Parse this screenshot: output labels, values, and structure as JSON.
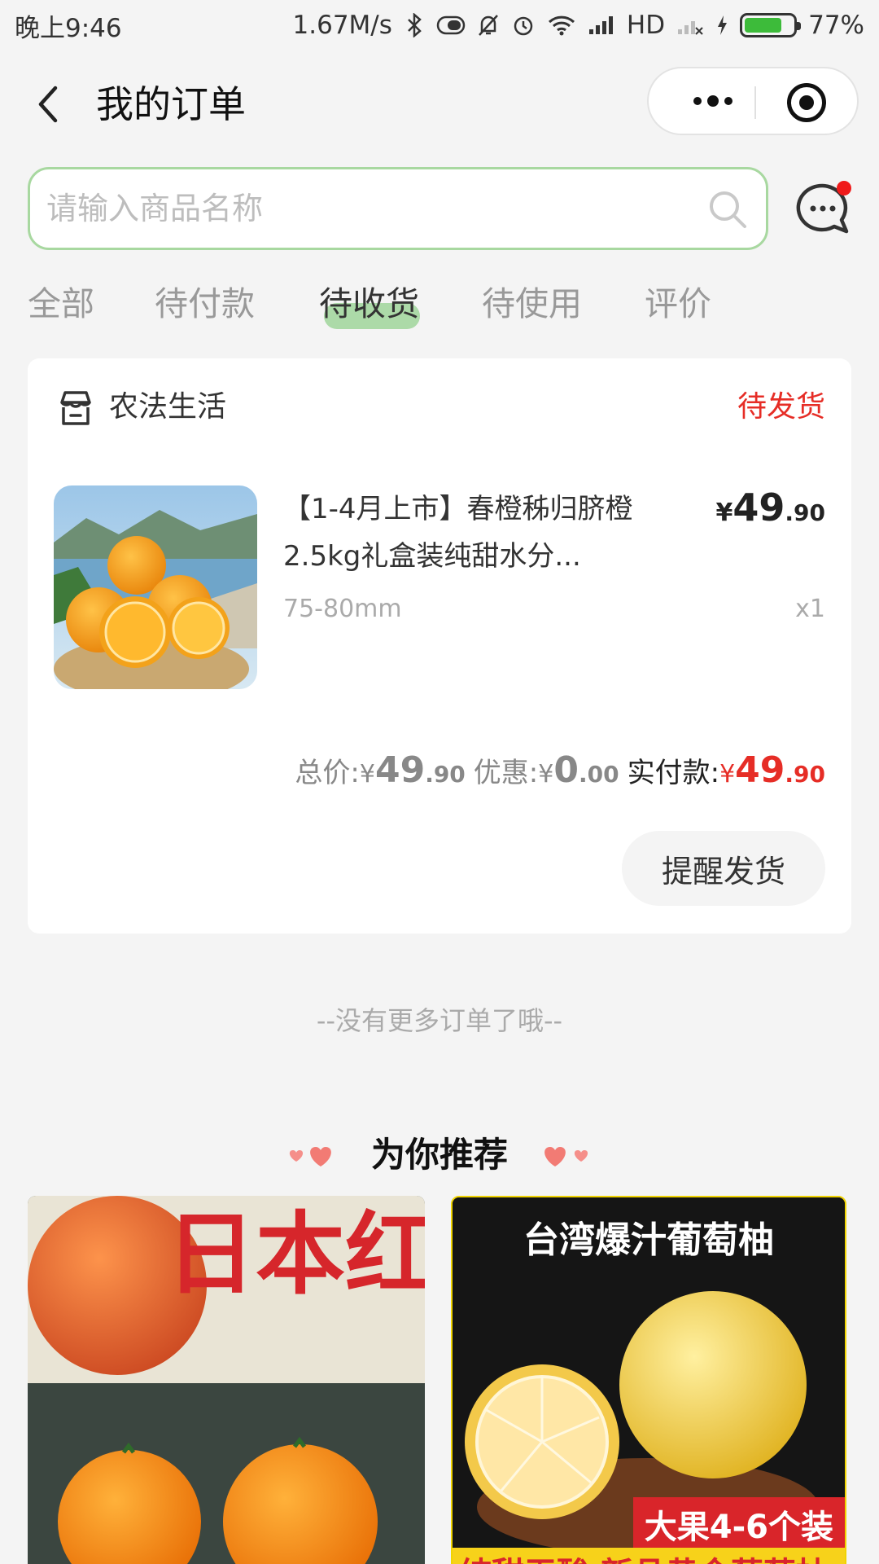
{
  "status_bar": {
    "time": "晚上9:46",
    "speed": "1.67M/s",
    "network": "HD",
    "battery": "77%",
    "battery_level": 0.77
  },
  "header": {
    "title": "我的订单"
  },
  "search": {
    "placeholder": "请输入商品名称"
  },
  "tabs": [
    {
      "label": "全部",
      "active": false
    },
    {
      "label": "待付款",
      "active": false
    },
    {
      "label": "待收货",
      "active": true
    },
    {
      "label": "待使用",
      "active": false
    },
    {
      "label": "评价",
      "active": false
    }
  ],
  "order": {
    "shop_name": "农法生活",
    "status": "待发货",
    "product": {
      "title": "【1-4月上市】春橙秭归脐橙2.5kg礼盒装纯甜水分...",
      "price_currency": "¥",
      "price_int": "49",
      "price_dec": ".90",
      "spec": "75-80mm",
      "quantity": "x1"
    },
    "summary": {
      "total_label": "总价:",
      "total_currency": "¥",
      "total_int": "49",
      "total_dec": ".90",
      "discount_label": "优惠:",
      "discount_currency": "¥",
      "discount_int": "0",
      "discount_dec": ".00",
      "paid_label": "实付款:",
      "paid_currency": "¥",
      "paid_int": "49",
      "paid_dec": ".90"
    },
    "remind_button": "提醒发货"
  },
  "no_more_text": "--没有更多订单了哦--",
  "recommend": {
    "title": "为你推荐",
    "items": [
      {
        "image_text": "日本红美人"
      },
      {
        "image_text": "台湾爆汁葡萄柚",
        "badge": "大果4-6个装",
        "strip": "纯甜无酸 新品黄金葡萄柚"
      }
    ]
  },
  "colors": {
    "accent_green": "#a8d8a0",
    "status_red": "#e62d26",
    "background": "#f4f4f4"
  }
}
